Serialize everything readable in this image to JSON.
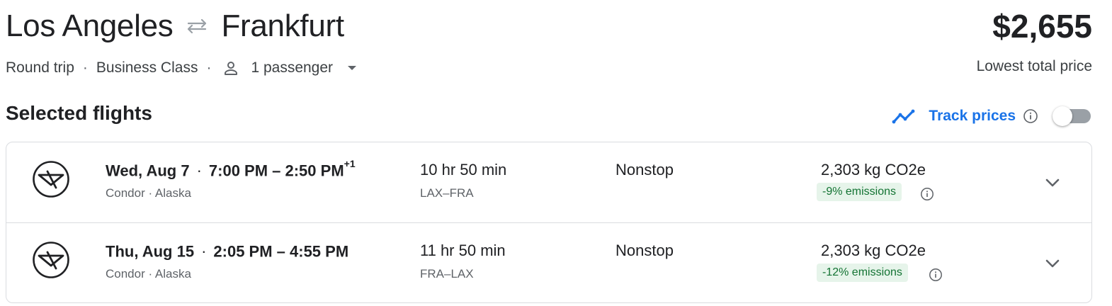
{
  "route": {
    "origin": "Los Angeles",
    "destination": "Frankfurt",
    "swap_icon": "swap-arrows-icon"
  },
  "trip": {
    "type": "Round trip",
    "cabin": "Business Class",
    "passengers": "1 passenger",
    "dot": "·"
  },
  "price": {
    "amount": "$2,655",
    "label": "Lowest total price"
  },
  "selected": {
    "title": "Selected flights",
    "track_label": "Track prices",
    "track_enabled": false
  },
  "flights": [
    {
      "date": "Wed, Aug 7",
      "time_range": "7:00 PM – 2:50 PM",
      "day_offset": "+1",
      "airlines": "Condor · Alaska",
      "duration": "10 hr 50 min",
      "airports": "LAX–FRA",
      "stops": "Nonstop",
      "co2": "2,303 kg CO2e",
      "emissions": "-9% emissions"
    },
    {
      "date": "Thu, Aug 15",
      "time_range": "2:05 PM – 4:55 PM",
      "day_offset": "",
      "airlines": "Condor · Alaska",
      "duration": "11 hr 50 min",
      "airports": "FRA–LAX",
      "stops": "Nonstop",
      "co2": "2,303 kg CO2e",
      "emissions": "-12% emissions"
    }
  ],
  "colors": {
    "accent": "#1a73e8",
    "emissions_text": "#137333",
    "emissions_bg": "#e6f4ea"
  }
}
